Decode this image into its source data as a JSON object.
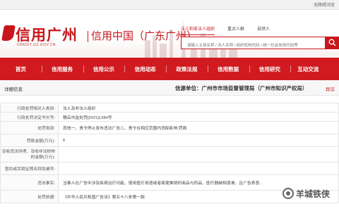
{
  "topbar": {
    "accessibility": "无障碍浏览"
  },
  "header": {
    "brand": "信用广州",
    "domain": "CREDIT.GZ.GOV.CN",
    "site_title": "信用中国（广东广州）"
  },
  "search": {
    "tabs": [
      "法人和非法人组织",
      "重点人群",
      "自然人"
    ],
    "placeholder": "请输入主体名称 / 法人名称 / 组织机构代码 / 统一社会信用代码等"
  },
  "nav": {
    "items": [
      "首页",
      "信用服务",
      "信用公示",
      "信用动态",
      "政策法规",
      "信用数据",
      "信用研究",
      "互动交流"
    ]
  },
  "detail": {
    "title": "详细信息",
    "source_label": "信源单位：",
    "source_value": "广州市市场监督管理局（广州市知识产权局）",
    "objection": "异议",
    "rows": [
      {
        "label": "行政处罚相对人类别:",
        "value": "法人及非法人组织"
      },
      {
        "label": "行政处罚决定书文号:",
        "value": "穗云市监处罚[2021]1284号"
      },
      {
        "label": "处罚类别:",
        "value": "其他一、责令停止发布违法广告二、责令在相应范围内消除影响;罚款"
      },
      {
        "label": "罚款金额(万元):",
        "value": "6"
      },
      {
        "label": "没收违法所得、没收非法财物的金额(万元):",
        "value": ""
      },
      {
        "label": "暂扣或吊销证照名称及编号:",
        "value": ""
      },
      {
        "label": "违法事实:",
        "value": "当事人在广告中涉及疾病治疗功能、使用医疗用语或者易使推销的商品与药品、医疗器械相混淆，且广告表意..."
      },
      {
        "label": "处罚依据:",
        "value": "《中华人民共和国广告法》第五十八条第一款"
      }
    ]
  },
  "colors": {
    "brand_red": "#c8161d",
    "nav_red": "#d11a1f"
  },
  "watermark": {
    "text": "羊城铁侠"
  }
}
